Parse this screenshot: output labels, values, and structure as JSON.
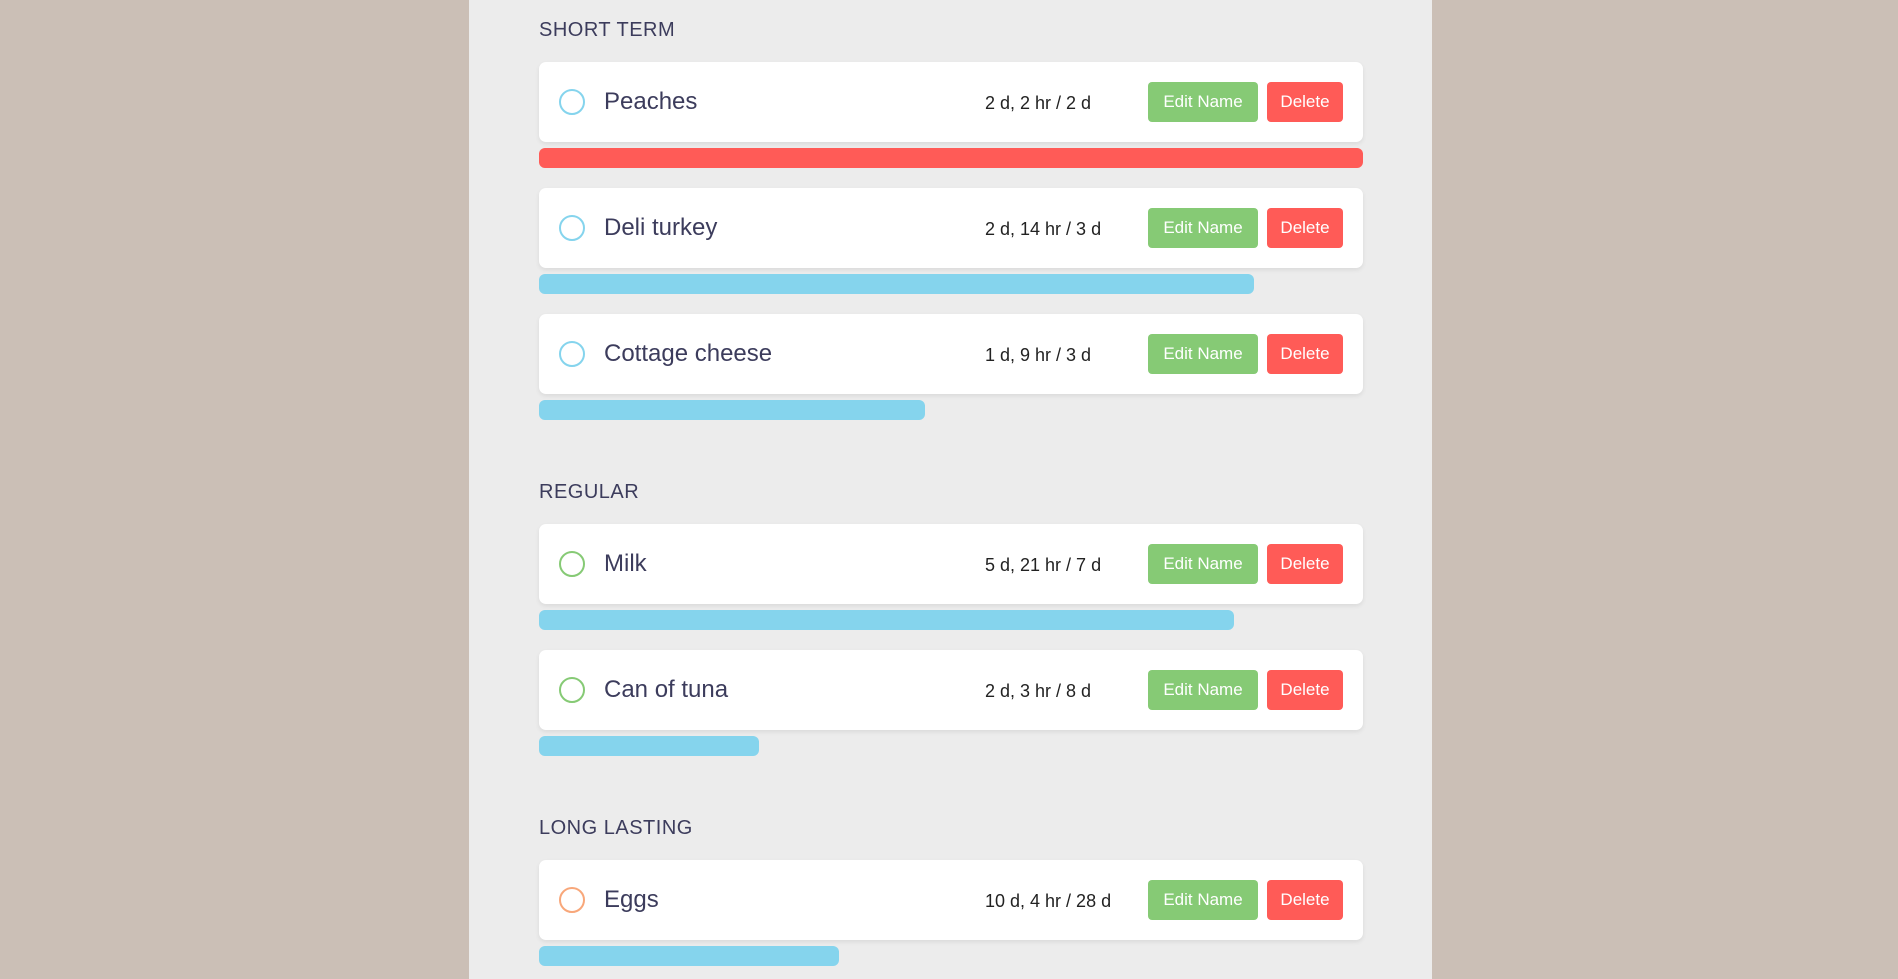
{
  "colors": {
    "background": "#cbbfb6",
    "panel": "#ececec",
    "edit_button": "#86ca75",
    "delete_button": "#ff5b57",
    "bar_normal": "#85d4ed",
    "bar_expired": "#ff5b57",
    "circle_short": "#85d4ed",
    "circle_regular": "#86ca75",
    "circle_long": "#f8a77a"
  },
  "sections": [
    {
      "title": "SHORT TERM",
      "items": [
        {
          "name": "Peaches",
          "time": "2 d, 2 hr / 2 d",
          "edit_label": "Edit Name",
          "delete_label": "Delete",
          "progress": 1.0,
          "status": "expired"
        },
        {
          "name": "Deli turkey",
          "time": "2 d, 14 hr / 3 d",
          "edit_label": "Edit Name",
          "delete_label": "Delete",
          "progress": 0.868,
          "status": "normal"
        },
        {
          "name": "Cottage cheese",
          "time": "1 d, 9 hr / 3 d",
          "edit_label": "Edit Name",
          "delete_label": "Delete",
          "progress": 0.468,
          "status": "normal"
        }
      ]
    },
    {
      "title": "REGULAR",
      "items": [
        {
          "name": "Milk",
          "time": "5 d, 21 hr / 7 d",
          "edit_label": "Edit Name",
          "delete_label": "Delete",
          "progress": 0.843,
          "status": "normal"
        },
        {
          "name": "Can of tuna",
          "time": "2 d, 3 hr / 8 d",
          "edit_label": "Edit Name",
          "delete_label": "Delete",
          "progress": 0.267,
          "status": "normal"
        }
      ]
    },
    {
      "title": "LONG LASTING",
      "items": [
        {
          "name": "Eggs",
          "time": "10 d, 4 hr / 28 d",
          "edit_label": "Edit Name",
          "delete_label": "Delete",
          "progress": 0.364,
          "status": "normal"
        }
      ]
    }
  ]
}
